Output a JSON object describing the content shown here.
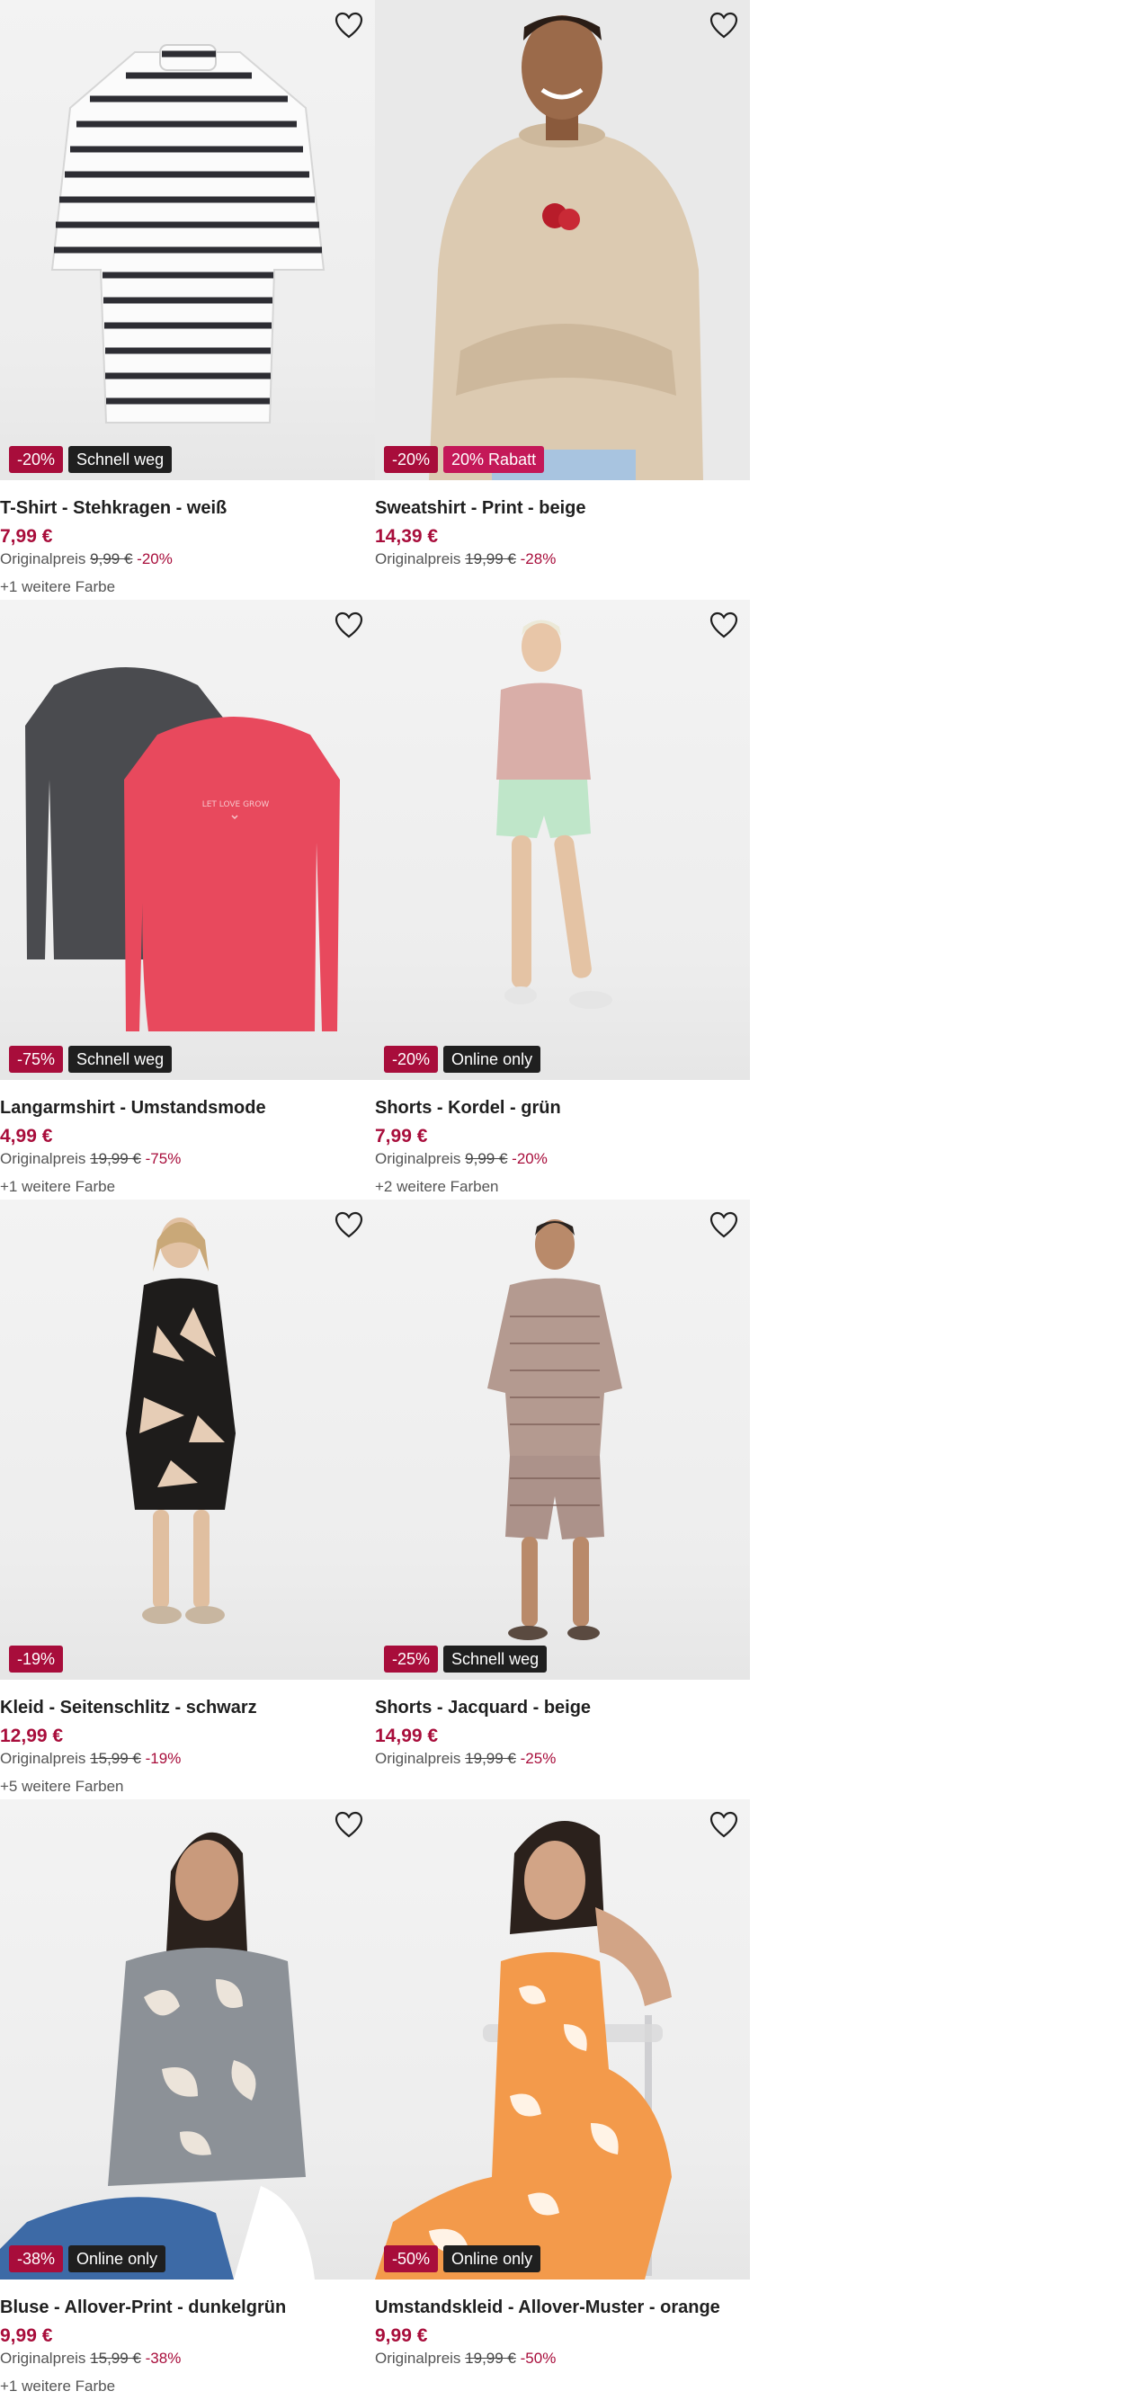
{
  "products": [
    {
      "title": "T-Shirt - Stehkragen - weiß",
      "price": "7,99 €",
      "original_label": "Originalpreis",
      "original_price": "9,99 €",
      "discount": "-20%",
      "more_colors": "+1 weitere Farbe",
      "badges": [
        {
          "text": "-20%",
          "type": "discount"
        },
        {
          "text": "Schnell weg",
          "type": "dark"
        }
      ]
    },
    {
      "title": "Sweatshirt - Print - beige",
      "price": "14,39 €",
      "original_label": "Originalpreis",
      "original_price": "19,99 €",
      "discount": "-28%",
      "more_colors": "",
      "badges": [
        {
          "text": "-20%",
          "type": "discount"
        },
        {
          "text": "20% Rabatt",
          "type": "promo"
        }
      ]
    },
    {
      "title": "Langarmshirt - Umstandsmode",
      "price": "4,99 €",
      "original_label": "Originalpreis",
      "original_price": "19,99 €",
      "discount": "-75%",
      "more_colors": "+1 weitere Farbe",
      "badges": [
        {
          "text": "-75%",
          "type": "discount"
        },
        {
          "text": "Schnell weg",
          "type": "dark"
        }
      ],
      "print_text": "LET LOVE GROW"
    },
    {
      "title": "Shorts - Kordel - grün",
      "price": "7,99 €",
      "original_label": "Originalpreis",
      "original_price": "9,99 €",
      "discount": "-20%",
      "more_colors": "+2 weitere Farben",
      "badges": [
        {
          "text": "-20%",
          "type": "discount"
        },
        {
          "text": "Online only",
          "type": "dark"
        }
      ]
    },
    {
      "title": "Kleid - Seitenschlitz - schwarz",
      "price": "12,99 €",
      "original_label": "Originalpreis",
      "original_price": "15,99 €",
      "discount": "-19%",
      "more_colors": "+5 weitere Farben",
      "badges": [
        {
          "text": "-19%",
          "type": "discount"
        }
      ]
    },
    {
      "title": "Shorts - Jacquard - beige",
      "price": "14,99 €",
      "original_label": "Originalpreis",
      "original_price": "19,99 €",
      "discount": "-25%",
      "more_colors": "",
      "badges": [
        {
          "text": "-25%",
          "type": "discount"
        },
        {
          "text": "Schnell weg",
          "type": "dark"
        }
      ]
    },
    {
      "title": "Bluse - Allover-Print - dunkelgrün",
      "price": "9,99 €",
      "original_label": "Originalpreis",
      "original_price": "15,99 €",
      "discount": "-38%",
      "more_colors": "+1 weitere Farbe",
      "badges": [
        {
          "text": "-38%",
          "type": "discount"
        },
        {
          "text": "Online only",
          "type": "dark"
        }
      ]
    },
    {
      "title": "Umstandskleid - Allover-Muster - orange",
      "price": "9,99 €",
      "original_label": "Originalpreis",
      "original_price": "19,99 €",
      "discount": "-50%",
      "more_colors": "",
      "badges": [
        {
          "text": "-50%",
          "type": "discount"
        },
        {
          "text": "Online only",
          "type": "dark"
        }
      ]
    }
  ],
  "colors": {
    "price_accent": "#a80d3b",
    "badge_dark": "#1f1f1f",
    "badge_promo": "#c41858"
  },
  "icons": {
    "wishlist": "heart-outline-icon"
  }
}
